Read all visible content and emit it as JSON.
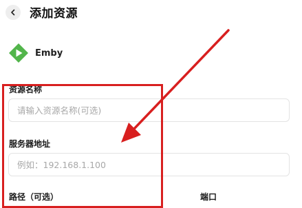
{
  "header": {
    "title": "添加资源",
    "back_icon": "chevron-left-icon"
  },
  "brand": {
    "name": "Emby",
    "logo_icon": "emby-logo-icon",
    "logo_color": "#52b54b"
  },
  "form": {
    "resource_name": {
      "label": "资源名称",
      "placeholder": "请输入资源名称(可选)"
    },
    "server_address": {
      "label": "服务器地址",
      "placeholder": "例如：192.168.1.100"
    },
    "path": {
      "label": "路径（可选）"
    },
    "port": {
      "label": "端口"
    }
  },
  "annotation": {
    "color": "#d81f1f"
  }
}
